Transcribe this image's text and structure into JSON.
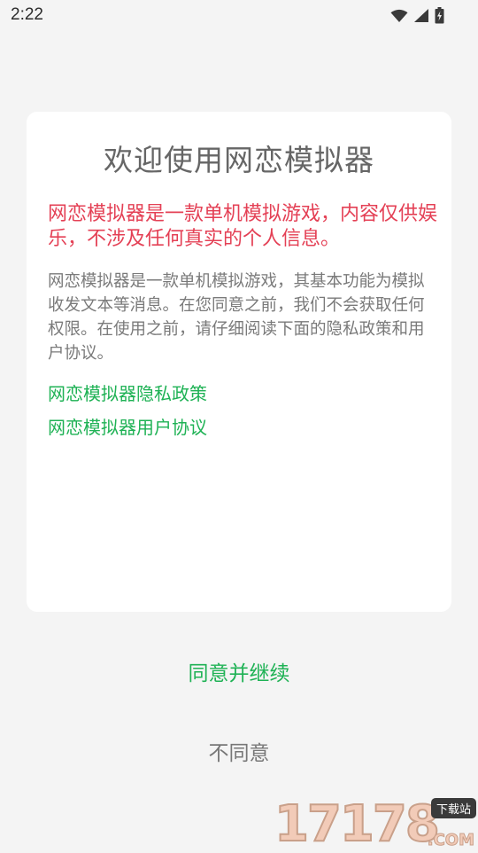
{
  "status_bar": {
    "time": "2:22",
    "icons": [
      "wifi-icon",
      "cellular-signal-icon",
      "battery-charging-icon"
    ]
  },
  "dialog": {
    "title": "欢迎使用网恋模拟器",
    "notice": "网恋模拟器是一款单机模拟游戏，内容仅供娱乐，不涉及任何真实的个人信息。",
    "body": "网恋模拟器是一款单机模拟游戏，其基本功能为模拟收发文本等消息。在您同意之前，我们不会获取任何权限。在使用之前，请仔细阅读下面的隐私政策和用户协议。",
    "links": {
      "privacy_policy": "网恋模拟器隐私政策",
      "user_agreement": "网恋模拟器用户协议"
    }
  },
  "actions": {
    "agree": "同意并继续",
    "disagree": "不同意"
  },
  "watermark": {
    "digits": "17178",
    "badge": "下载站",
    "suffix": ".COM"
  },
  "colors": {
    "background": "#f4f4f4",
    "card": "#ffffff",
    "notice_red": "#e44055",
    "link_green": "#1fb255",
    "body_gray": "#7a7a7a"
  }
}
